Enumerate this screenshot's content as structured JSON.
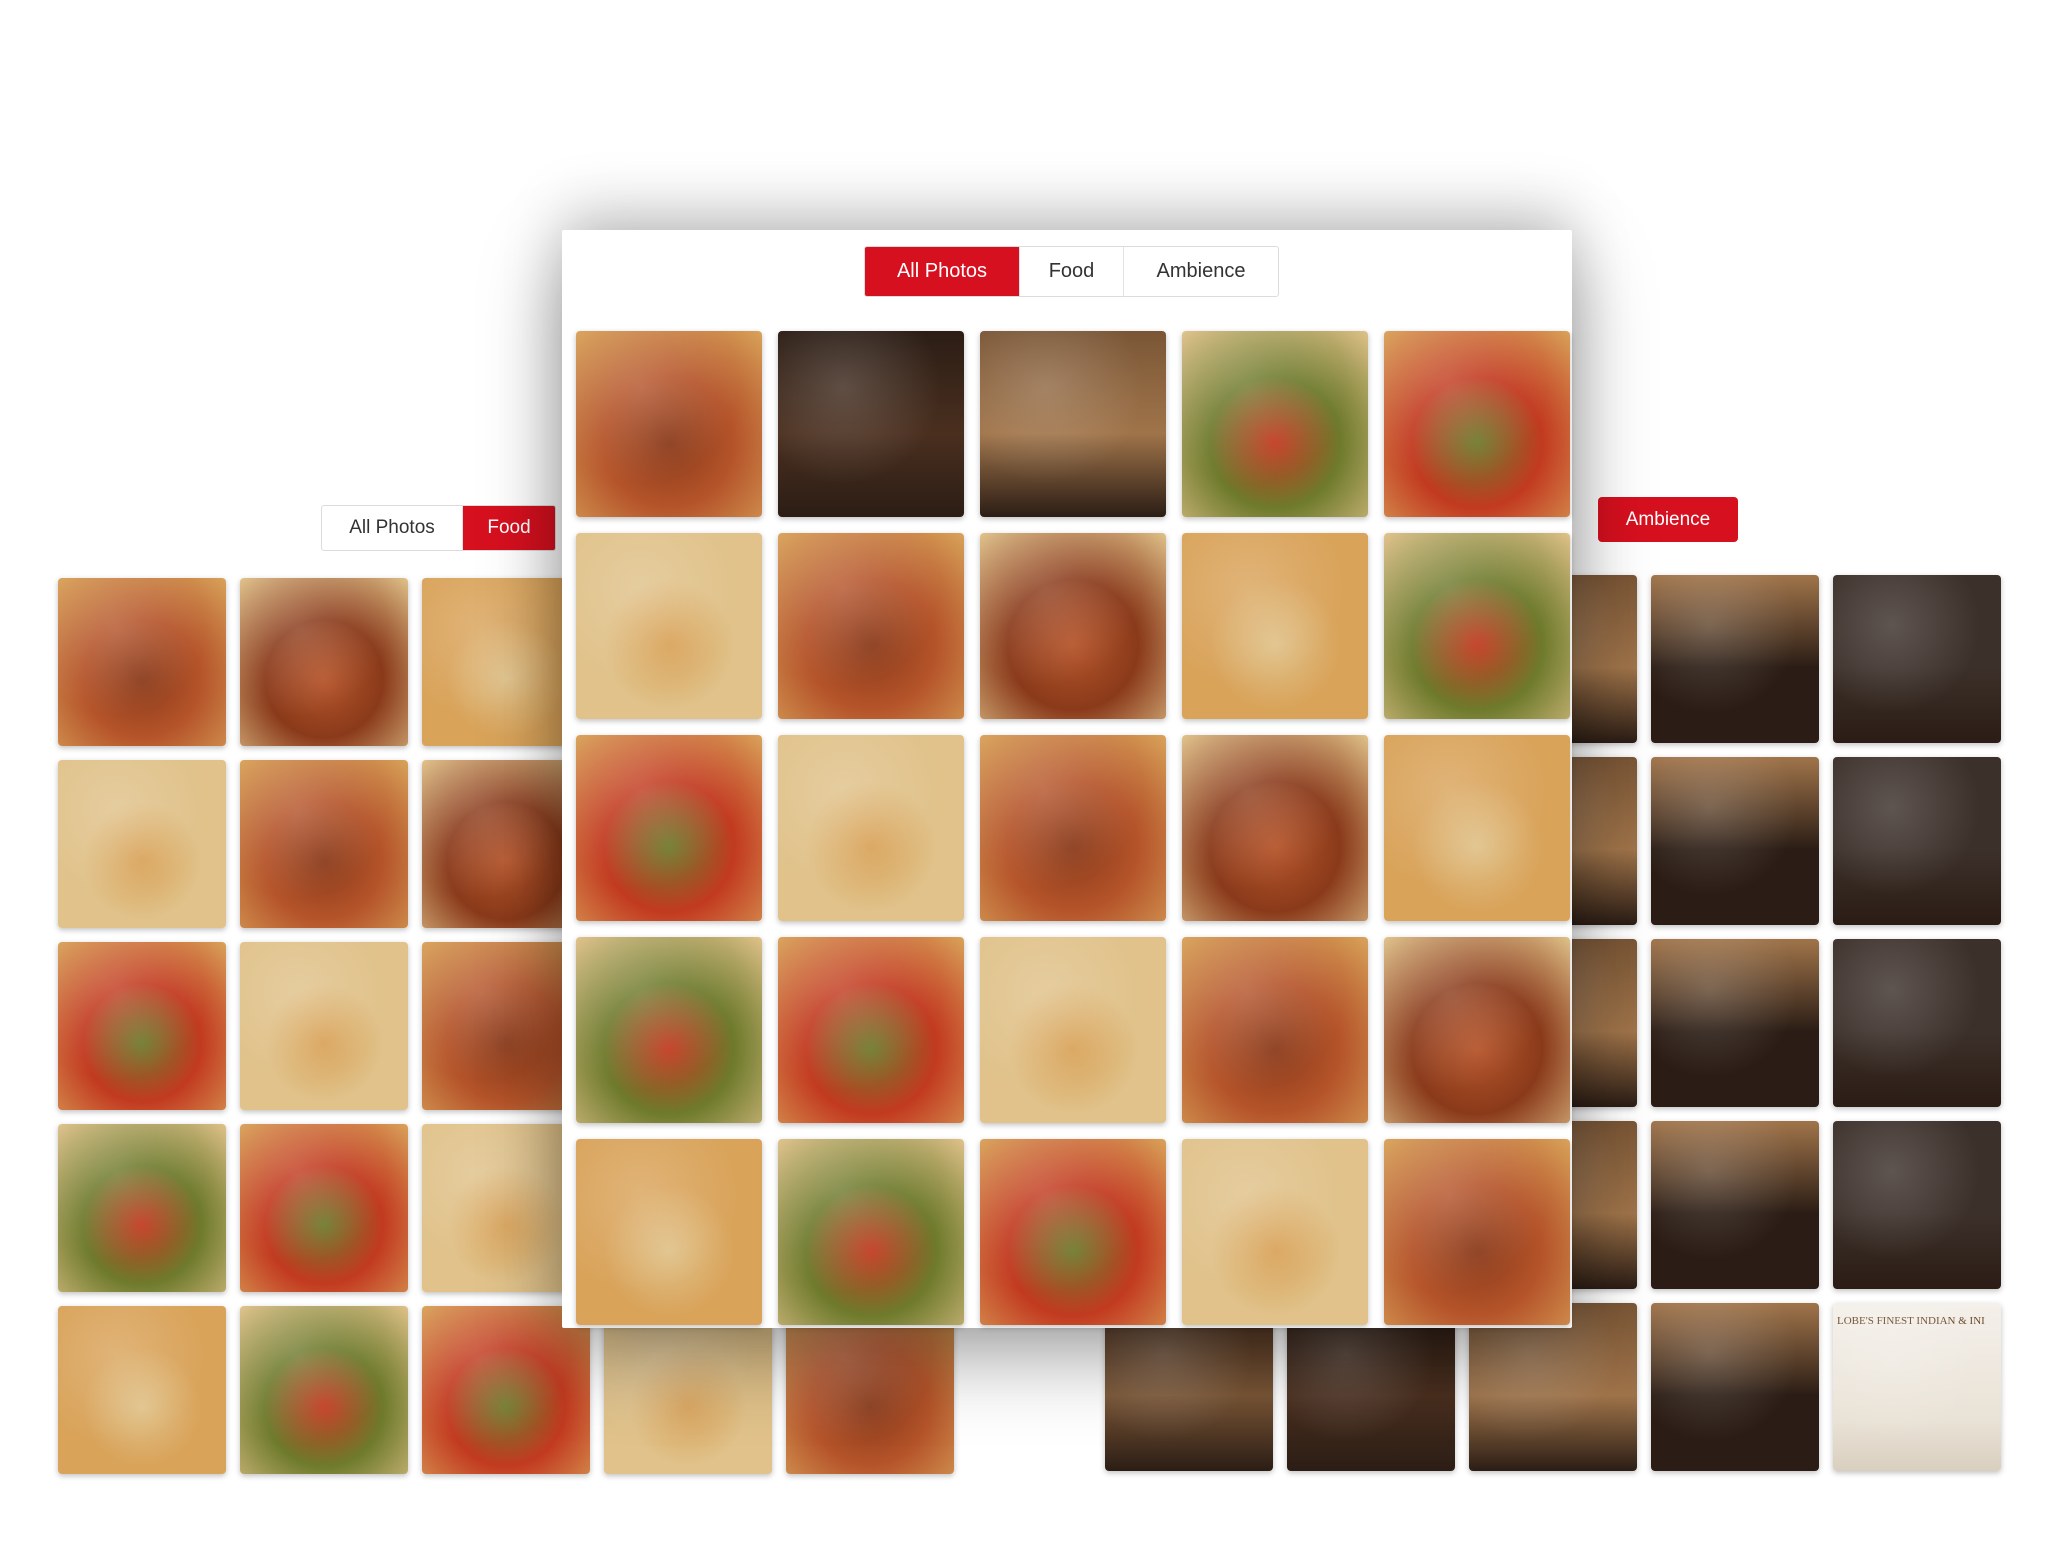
{
  "background_left": {
    "tabs": [
      {
        "label": "All Photos",
        "active": false
      },
      {
        "label": "Food",
        "active": true
      }
    ],
    "photos": [
      "food",
      "food",
      "food",
      "food",
      "food",
      "food",
      "food",
      "food",
      "food",
      "food",
      "food",
      "food",
      "food",
      "food",
      "food",
      "food",
      "food",
      "food",
      "food",
      "food",
      "food",
      "food",
      "food",
      "food",
      "food"
    ]
  },
  "background_right": {
    "ambience_label": "Ambience",
    "photos": [
      "ambience",
      "ambience",
      "ambience",
      "ambience",
      "ambience",
      "ambience",
      "ambience",
      "ambience",
      "ambience",
      "ambience",
      "ambience",
      "ambience",
      "ambience",
      "ambience",
      "ambience",
      "ambience",
      "ambience",
      "ambience",
      "ambience",
      "ambience",
      "ambience",
      "ambience",
      "ambience",
      "ambience",
      "ambience"
    ],
    "sign_text": "LOBE'S FINEST INDIAN & INI"
  },
  "modal": {
    "tabs": [
      {
        "label": "All Photos",
        "active": true
      },
      {
        "label": "Food",
        "active": false
      },
      {
        "label": "Ambience",
        "active": false
      }
    ],
    "photos": [
      "food",
      "ambience",
      "ambience",
      "food",
      "food",
      "food",
      "food",
      "food",
      "food",
      "food",
      "food",
      "food",
      "food",
      "food",
      "food",
      "food",
      "food",
      "food",
      "food",
      "food",
      "food",
      "food",
      "food",
      "food",
      "food"
    ]
  },
  "colors": {
    "accent": "#d7101f",
    "food_palette": [
      "#b5542a",
      "#8a3a1a",
      "#d9a35a",
      "#6e7a2c",
      "#c23a20",
      "#e0c28a"
    ],
    "ambience_palette": [
      "#4a2f1f",
      "#2b1d15",
      "#7a5636",
      "#a0744a",
      "#3c302a"
    ]
  }
}
